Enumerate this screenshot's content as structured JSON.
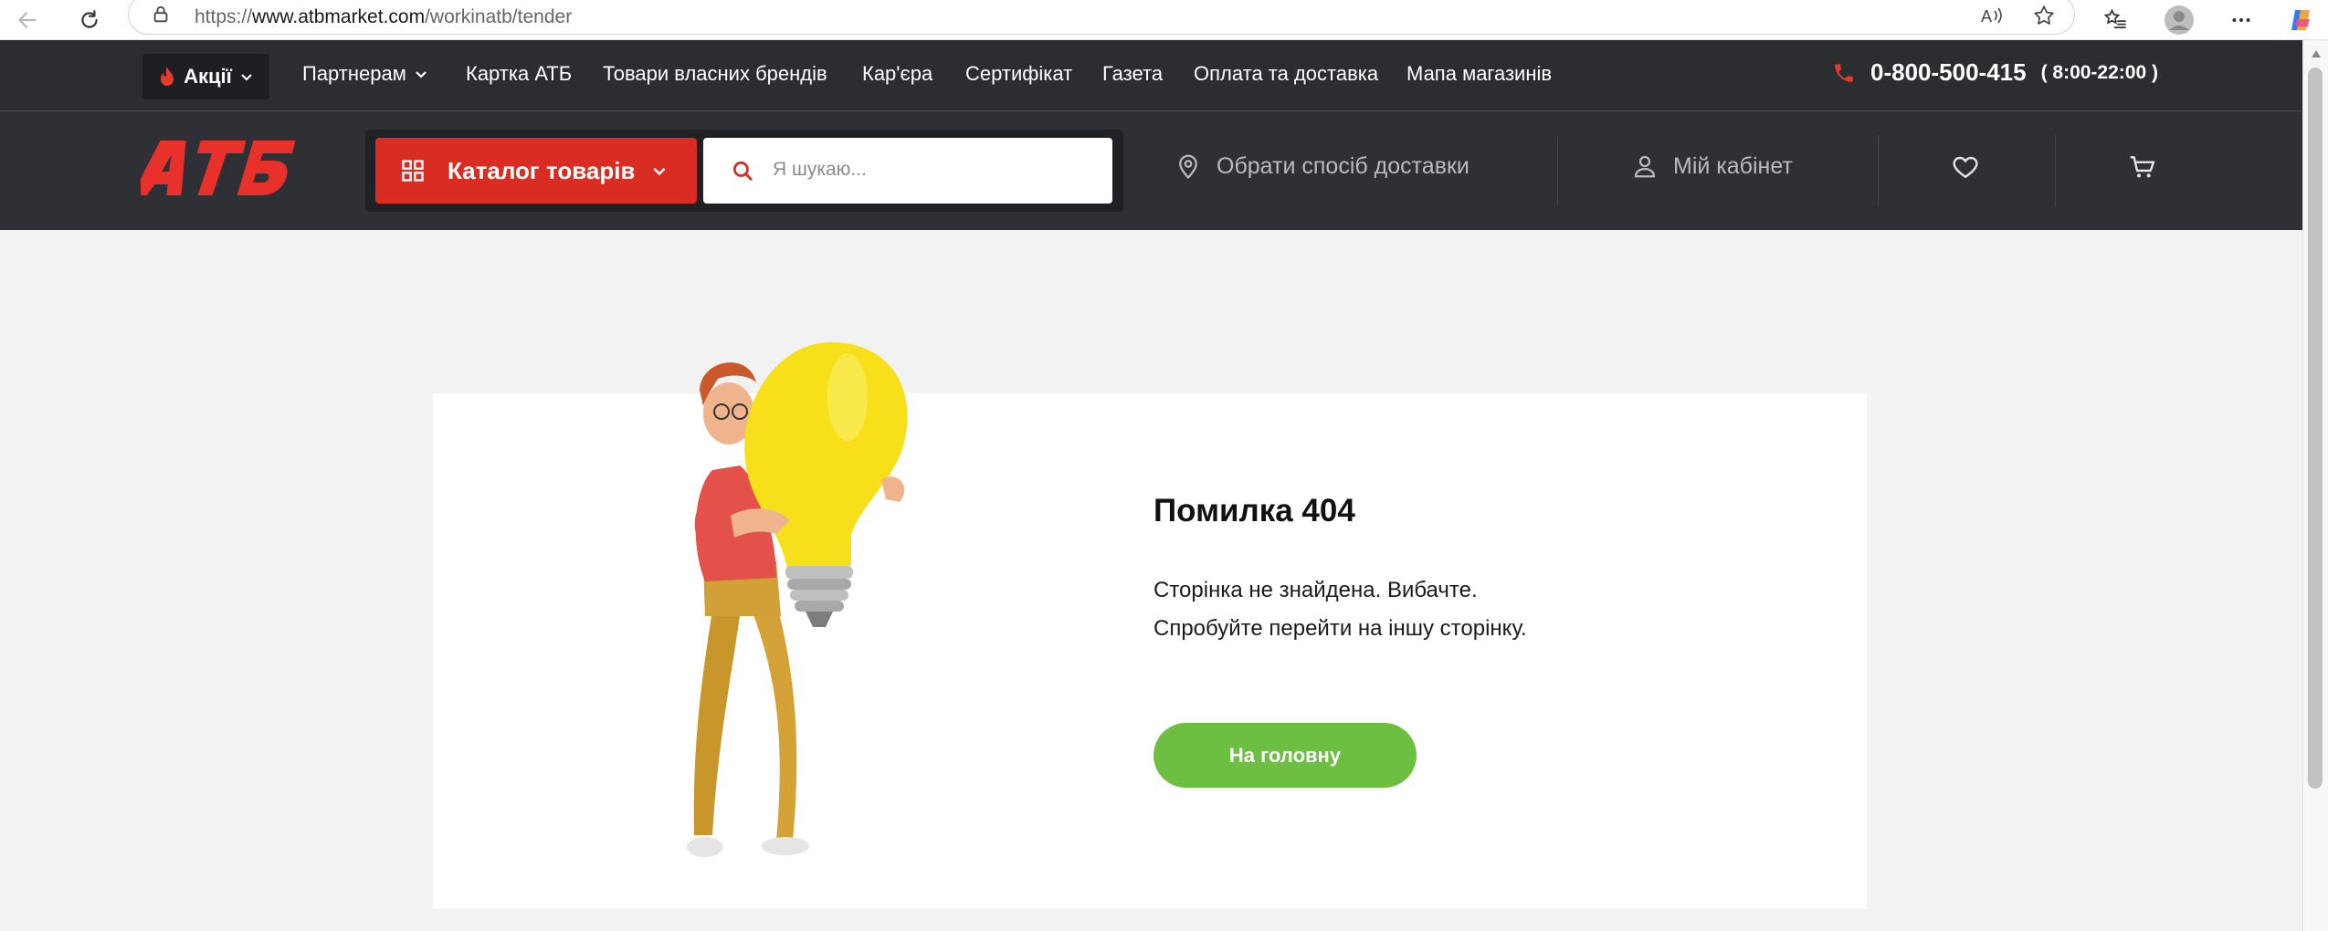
{
  "browser": {
    "url_prefix": "https://",
    "url_host": "www.atbmarket.com",
    "url_path": "/workinatb/tender"
  },
  "top_nav": {
    "promo_label": "Акції",
    "links": [
      "Партнерам",
      "Картка АТБ",
      "Товари власних брендів",
      "Кар'єра",
      "Сертифікат",
      "Газета",
      "Оплата та доставка",
      "Мапа магазинів"
    ],
    "phone": "0-800-500-415",
    "hours": "( 8:00-22:00 )"
  },
  "header": {
    "logo_text": "АТБ",
    "catalog_label": "Каталог товарів",
    "search_placeholder": "Я шукаю...",
    "delivery_label": "Обрати спосіб доставки",
    "account_label": "Мій кабінет"
  },
  "error": {
    "title": "Помилка 404",
    "line1": "Сторінка не знайдена. Вибачте.",
    "line2": "Спробуйте перейти на іншу сторінку.",
    "button_label": "На головну"
  },
  "colors": {
    "brand_red": "#d92c22",
    "dark_bg": "#2e3035",
    "button_green": "#6cbf41"
  }
}
